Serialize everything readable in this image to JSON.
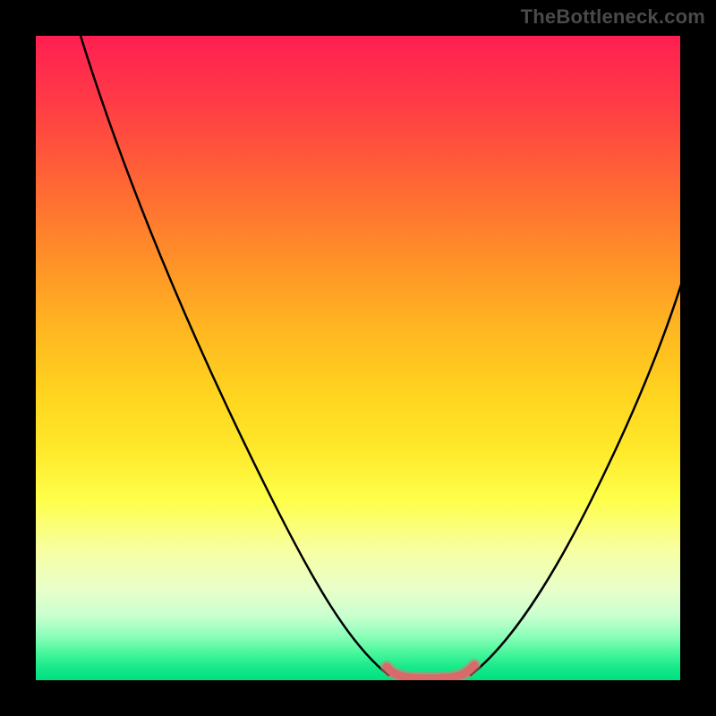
{
  "watermark": "TheBottleneck.com",
  "chart_data": {
    "type": "line",
    "title": "",
    "xlabel": "",
    "ylabel": "",
    "xlim": [
      0,
      100
    ],
    "ylim": [
      0,
      100
    ],
    "grid": false,
    "legend": false,
    "series": [
      {
        "name": "bottleneck-curve-left",
        "color": "#000000",
        "x": [
          7,
          12,
          18,
          24,
          30,
          36,
          42,
          48,
          53,
          56
        ],
        "values": [
          100,
          86,
          71,
          57,
          43,
          30,
          18,
          8,
          2,
          0
        ]
      },
      {
        "name": "bottleneck-curve-right",
        "color": "#000000",
        "x": [
          67,
          70,
          74,
          79,
          84,
          89,
          94,
          100
        ],
        "values": [
          0,
          2,
          7,
          15,
          25,
          36,
          48,
          62
        ]
      },
      {
        "name": "ideal-band",
        "color": "#e06a6a",
        "x": [
          55,
          57,
          60,
          63,
          66,
          68
        ],
        "values": [
          1.5,
          0.4,
          0,
          0,
          0.4,
          1.5
        ]
      }
    ],
    "gradient": {
      "name": "bottleneck-heat",
      "stops": [
        {
          "pos": 0,
          "color": "#ff1f52"
        },
        {
          "pos": 24,
          "color": "#ff6a33"
        },
        {
          "pos": 56,
          "color": "#ffd51f"
        },
        {
          "pos": 80,
          "color": "#f7ffa3"
        },
        {
          "pos": 93,
          "color": "#8fffba"
        },
        {
          "pos": 100,
          "color": "#00e080"
        }
      ]
    }
  }
}
